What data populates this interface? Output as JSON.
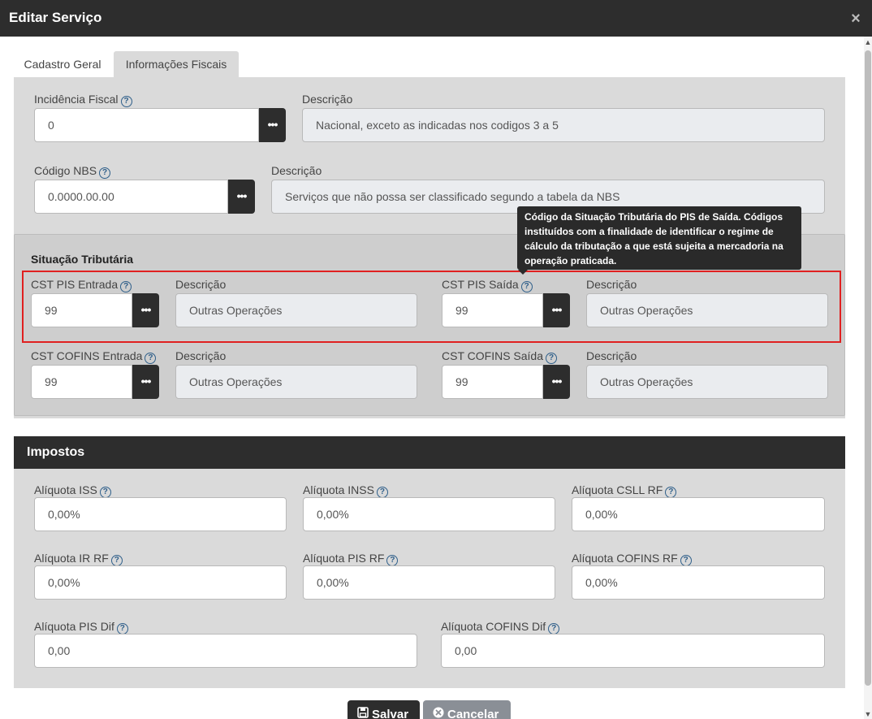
{
  "dialog": {
    "title": "Editar Serviço",
    "close_glyph": "×"
  },
  "tabs": [
    {
      "label": "Cadastro Geral",
      "active": false
    },
    {
      "label": "Informações Fiscais",
      "active": true
    }
  ],
  "fiscal": {
    "incidencia": {
      "label": "Incidência Fiscal",
      "value": "0",
      "desc_label": "Descrição",
      "desc_value": "Nacional, exceto as indicadas nos codigos 3 a 5"
    },
    "nbs": {
      "label": "Código NBS",
      "value": "0.0000.00.00",
      "desc_label": "Descrição",
      "desc_value": "Serviços que não possa ser classificado segundo a tabela da NBS"
    }
  },
  "situacao": {
    "title": "Situação Tributária",
    "pis_entrada": {
      "label": "CST PIS Entrada",
      "value": "99",
      "desc_label": "Descrição",
      "desc_value": "Outras Operações"
    },
    "pis_saida": {
      "label": "CST PIS Saída",
      "value": "99",
      "desc_label": "Descrição",
      "desc_value": "Outras Operações"
    },
    "cofins_entrada": {
      "label": "CST COFINS Entrada",
      "value": "99",
      "desc_label": "Descrição",
      "desc_value": "Outras Operações"
    },
    "cofins_saida": {
      "label": "CST COFINS Saída",
      "value": "99",
      "desc_label": "Descrição",
      "desc_value": "Outras Operações"
    }
  },
  "tooltip": {
    "text": "Código da Situação Tributária do PIS de Saída. Códigos instituídos com a finalidade de identificar o regime de cálculo da tributação a que está sujeita a mercadoria na operação praticada."
  },
  "impostos": {
    "title": "Impostos",
    "iss": {
      "label": "Alíquota ISS",
      "value": "0,00%"
    },
    "inss": {
      "label": "Alíquota INSS",
      "value": "0,00%"
    },
    "csll_rf": {
      "label": "Alíquota CSLL RF",
      "value": "0,00%"
    },
    "ir_rf": {
      "label": "Alíquota IR RF",
      "value": "0,00%"
    },
    "pis_rf": {
      "label": "Alíquota PIS RF",
      "value": "0,00%"
    },
    "cofins_rf": {
      "label": "Alíquota COFINS RF",
      "value": "0,00%"
    },
    "pis_dif": {
      "label": "Alíquota PIS Dif",
      "value": "0,00"
    },
    "cofins_dif": {
      "label": "Alíquota COFINS Dif",
      "value": "0,00"
    }
  },
  "actions": {
    "save_label": "Salvar",
    "cancel_label": "Cancelar"
  },
  "glyphs": {
    "help": "?",
    "ellipsis": "•••",
    "save_icon": "floppy-disk-icon",
    "cancel_icon": "x-circle-icon"
  }
}
